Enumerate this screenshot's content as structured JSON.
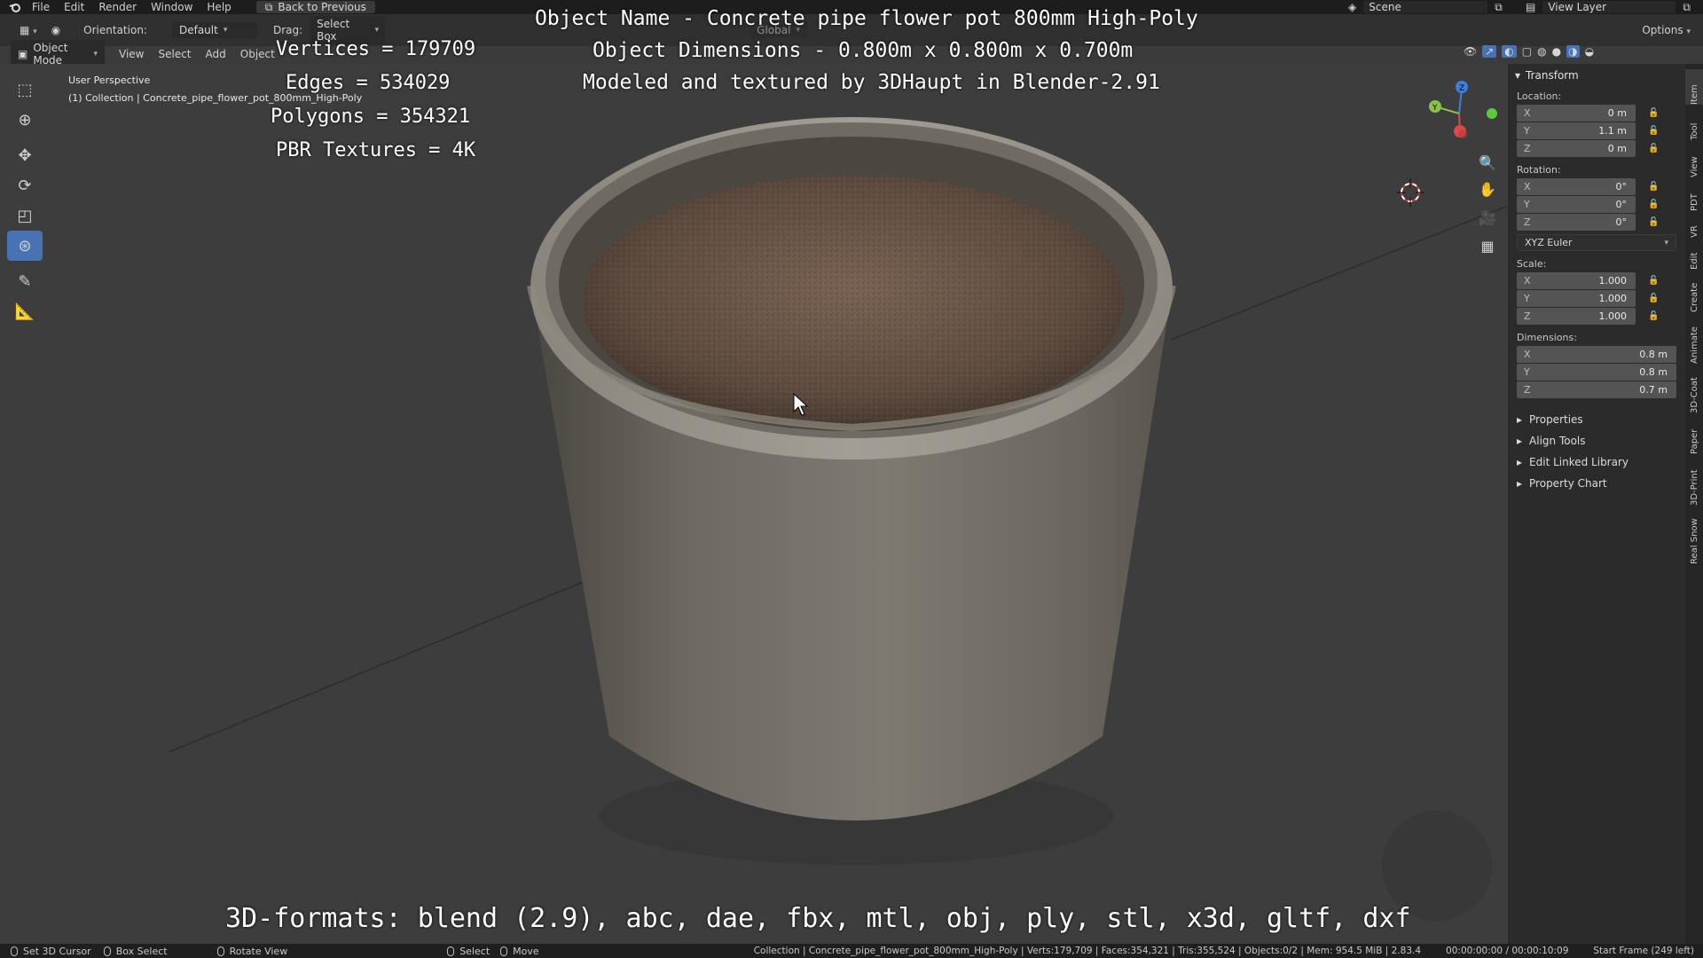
{
  "menu": {
    "items": [
      "File",
      "Edit",
      "Render",
      "Window",
      "Help"
    ],
    "back_button": "Back to Previous"
  },
  "scene": {
    "label": "Scene",
    "view_layer": "View Layer"
  },
  "header": {
    "orientation_label": "Orientation:",
    "orientation_value": "Default",
    "drag_label": "Drag:",
    "drag_value": "Select Box",
    "transform_space": "Global",
    "options": "Options",
    "mode": "Object Mode",
    "menus": [
      "View",
      "Select",
      "Add",
      "Object"
    ]
  },
  "viewport": {
    "perspective": "User Perspective",
    "collection": "(1) Collection | Concrete_pipe_flower_pot_800mm_High-Poly"
  },
  "overlay": {
    "object_name": "Object Name - Concrete pipe flower pot 800mm High-Poly",
    "dimensions": "Object Dimensions -  0.800m x 0.800m x 0.700m",
    "credits": "Modeled and textured by 3DHaupt in Blender-2.91",
    "vertices": "Vertices = 179709",
    "edges": "Edges = 534029",
    "polygons": "Polygons = 354321",
    "textures": "PBR Textures = 4K",
    "formats": "3D-formats: blend (2.9), abc, dae, fbx, mtl, obj, ply, stl, x3d, gltf, dxf"
  },
  "npanel": {
    "title": "Transform",
    "location_label": "Location:",
    "location": [
      {
        "axis": "X",
        "value": "0 m"
      },
      {
        "axis": "Y",
        "value": "1.1 m"
      },
      {
        "axis": "Z",
        "value": "0 m"
      }
    ],
    "rotation_label": "Rotation:",
    "rotation": [
      {
        "axis": "X",
        "value": "0°"
      },
      {
        "axis": "Y",
        "value": "0°"
      },
      {
        "axis": "Z",
        "value": "0°"
      }
    ],
    "rotation_mode": "XYZ Euler",
    "scale_label": "Scale:",
    "scale": [
      {
        "axis": "X",
        "value": "1.000"
      },
      {
        "axis": "Y",
        "value": "1.000"
      },
      {
        "axis": "Z",
        "value": "1.000"
      }
    ],
    "dimensions_label": "Dimensions:",
    "dimensions": [
      {
        "axis": "X",
        "value": "0.8 m"
      },
      {
        "axis": "Y",
        "value": "0.8 m"
      },
      {
        "axis": "Z",
        "value": "0.7 m"
      }
    ],
    "sections": [
      "Properties",
      "Align Tools",
      "Edit Linked Library",
      "Property Chart"
    ]
  },
  "vtabs": [
    "Item",
    "Tool",
    "View",
    "PDT",
    "VR",
    "Edit",
    "Create",
    "Animate",
    "3D-Coat",
    "Paper",
    "3D-Print",
    "Real Snow"
  ],
  "status": {
    "set_cursor": "Set 3D Cursor",
    "box_select": "Box Select",
    "rotate_view": "Rotate View",
    "select": "Select",
    "move": "Move",
    "info": "Collection | Concrete_pipe_flower_pot_800mm_High-Poly | Verts:179,709 | Faces:354,321 | Tris:355,524 | Objects:0/2 | Mem: 954.5 MiB | 2.83.4",
    "time": "00:00:00:00 / 00:00:10:09",
    "frame": "Start Frame (249 left)"
  },
  "colors": {
    "accent": "#4772b3",
    "x_axis": "#e0474b",
    "y_axis": "#8bc34a",
    "z_axis": "#3f7fe0"
  }
}
